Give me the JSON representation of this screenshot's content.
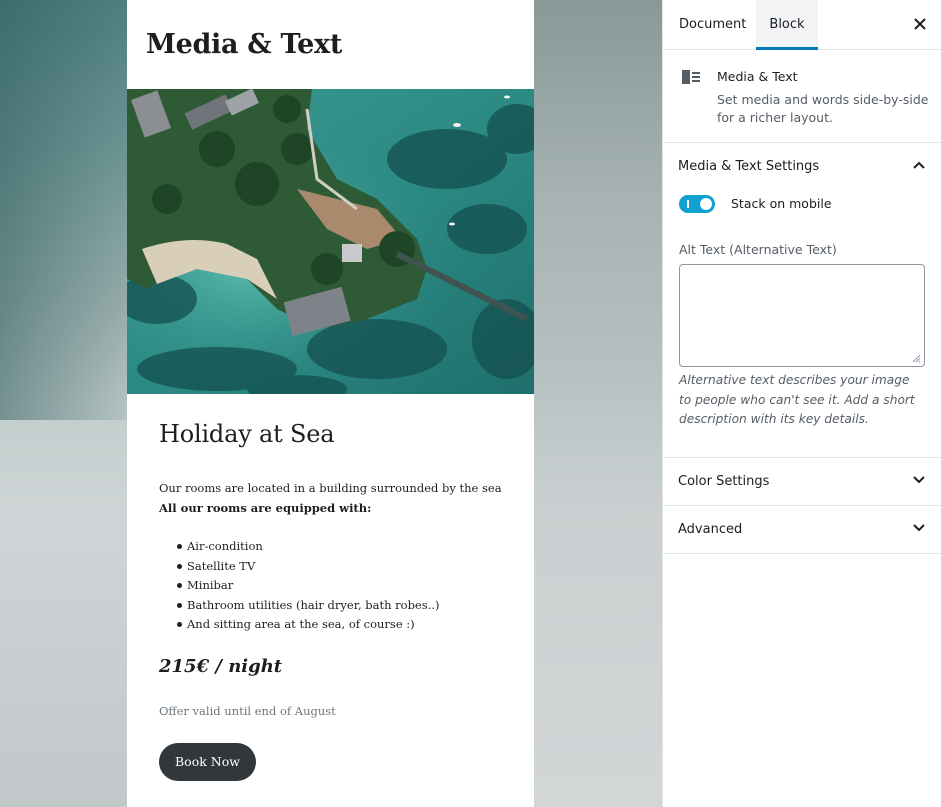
{
  "canvas": {
    "post_title": "Media & Text",
    "heading": "Holiday at Sea",
    "paragraph": "Our rooms are located in a building surrounded by the sea",
    "paragraph_bold": "All our rooms are equipped with:",
    "features": [
      "Air-condition",
      "Satellite TV",
      "Minibar",
      "Bathroom utilities (hair dryer, bath robes..)",
      "And sitting area at the sea, of course :)"
    ],
    "price": "215€ / night",
    "offer": "Offer valid until end of August",
    "button_label": "Book Now"
  },
  "sidebar": {
    "tabs": [
      {
        "label": "Document",
        "active": false
      },
      {
        "label": "Block",
        "active": true
      }
    ],
    "close_icon": "close-icon",
    "block": {
      "icon": "media-text-icon",
      "name": "Media & Text",
      "description": "Set media and words side-by-side for a richer layout."
    },
    "media_text_settings": {
      "title": "Media & Text Settings",
      "expanded": true,
      "stack_on_mobile_label": "Stack on mobile",
      "stack_on_mobile": true,
      "alt_text_label": "Alt Text (Alternative Text)",
      "alt_text_value": "",
      "alt_text_help": "Alternative text describes your image to people who can't see it. Add a short description with its key details."
    },
    "color_settings": {
      "title": "Color Settings",
      "expanded": false
    },
    "advanced": {
      "title": "Advanced",
      "expanded": false
    }
  },
  "colors": {
    "accent": "#007cba",
    "toggle": "#11a0d2",
    "button_bg": "#32373c",
    "sea": "#2f8b86"
  }
}
